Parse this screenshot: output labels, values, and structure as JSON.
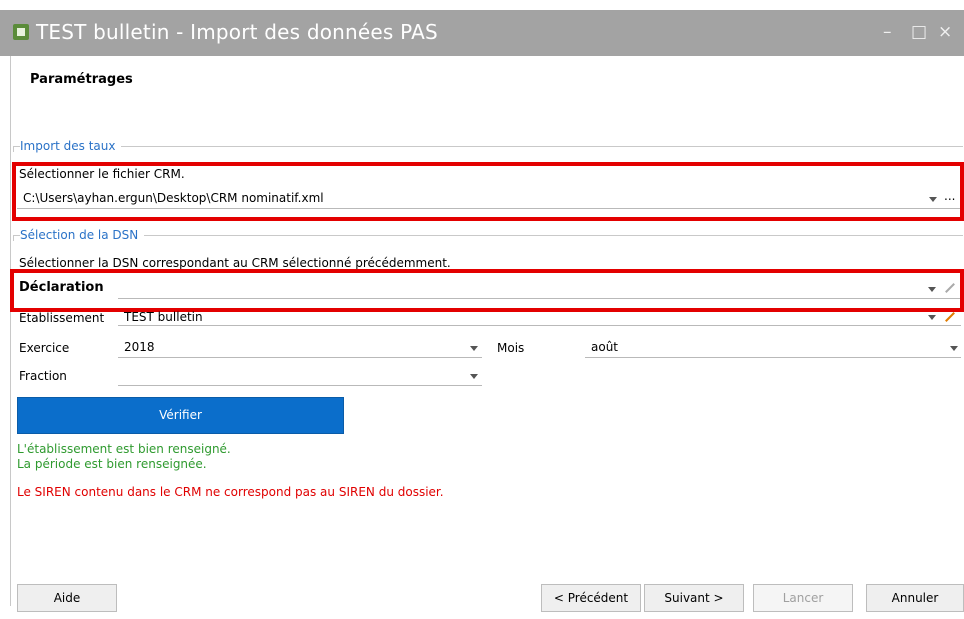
{
  "window": {
    "title": "TEST bulletin - Import des données PAS",
    "minimize": "–",
    "maximize": "□",
    "close": "×"
  },
  "settings_title": "Paramétrages",
  "import_group": {
    "label": "Import des taux",
    "select_label": "Sélectionner le fichier CRM.",
    "file_path": "C:\\Users\\ayhan.ergun\\Desktop\\CRM nominatif.xml",
    "browse": "..."
  },
  "dsn_group": {
    "label": "Sélection de la DSN",
    "instruction": "Sélectionner la DSN correspondant au CRM sélectionné précédemment.",
    "declaration_label": "Déclaration",
    "declaration_value": "",
    "etablissement_label": "Etablissement",
    "etablissement_value": "TEST bulletin",
    "exercice_label": "Exercice",
    "exercice_value": "2018",
    "mois_label": "Mois",
    "mois_value": "août",
    "fraction_label": "Fraction",
    "fraction_value": ""
  },
  "verify_button": "Vérifier",
  "messages": {
    "ok1": "L'établissement est bien renseigné.",
    "ok2": "La période est bien renseignée.",
    "error": "Le SIREN contenu dans le CRM ne correspond pas au SIREN du dossier."
  },
  "footer": {
    "help": "Aide",
    "previous": "< Précédent",
    "next": "Suivant >",
    "launch": "Lancer",
    "cancel": "Annuler"
  },
  "colors": {
    "titlebar": "#a3a3a3",
    "accent_blue": "#0b6ecb",
    "highlight_red": "#e30000",
    "success_green": "#2f9a2f",
    "error_red": "#e00000"
  }
}
